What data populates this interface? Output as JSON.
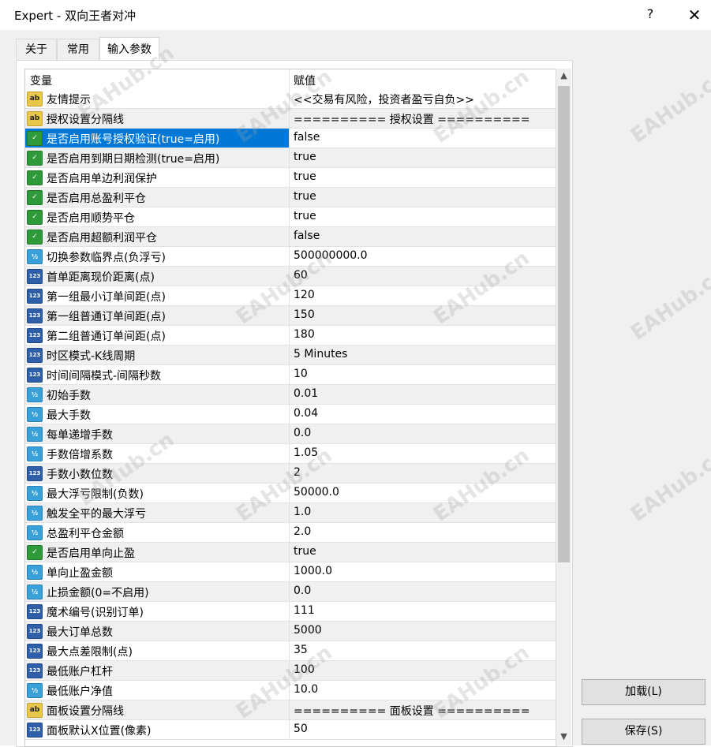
{
  "window": {
    "title": "Expert - 双向王者对冲",
    "help": "?",
    "close": "✕"
  },
  "tabs": [
    {
      "label": "关于"
    },
    {
      "label": "常用"
    },
    {
      "label": "输入参数"
    }
  ],
  "table": {
    "headers": {
      "variable": "变量",
      "value": "赋值"
    },
    "rows": [
      {
        "icon": "ab",
        "name": "友情提示",
        "value": "<<交易有风险，投资者盈亏自负>>"
      },
      {
        "icon": "ab",
        "name": "授权设置分隔线",
        "value": "========== 授权设置 =========="
      },
      {
        "icon": "bool",
        "name": "是否启用账号授权验证(true=启用)",
        "value": "false"
      },
      {
        "icon": "bool",
        "name": "是否启用到期日期检测(true=启用)",
        "value": "true"
      },
      {
        "icon": "bool",
        "name": "是否启用单边利润保护",
        "value": "true"
      },
      {
        "icon": "bool",
        "name": "是否启用总盈利平仓",
        "value": "true"
      },
      {
        "icon": "bool",
        "name": "是否启用顺势平仓",
        "value": "true"
      },
      {
        "icon": "bool",
        "name": "是否启用超额利润平仓",
        "value": "false"
      },
      {
        "icon": "v2",
        "name": "切换参数临界点(负浮亏)",
        "value": "500000000.0"
      },
      {
        "icon": "123",
        "name": "首单距离现价距离(点)",
        "value": "60"
      },
      {
        "icon": "123",
        "name": "第一组最小订单间距(点)",
        "value": "120"
      },
      {
        "icon": "123",
        "name": "第一组普通订单间距(点)",
        "value": "150"
      },
      {
        "icon": "123",
        "name": "第二组普通订单间距(点)",
        "value": "180"
      },
      {
        "icon": "123",
        "name": "时区模式-K线周期",
        "value": "5 Minutes"
      },
      {
        "icon": "123",
        "name": "时间间隔模式-间隔秒数",
        "value": "10"
      },
      {
        "icon": "v2",
        "name": "初始手数",
        "value": "0.01"
      },
      {
        "icon": "v2",
        "name": "最大手数",
        "value": "0.04"
      },
      {
        "icon": "v2",
        "name": "每单递增手数",
        "value": "0.0"
      },
      {
        "icon": "v2",
        "name": "手数倍增系数",
        "value": "1.05"
      },
      {
        "icon": "123",
        "name": "手数小数位数",
        "value": "2"
      },
      {
        "icon": "v2",
        "name": "最大浮亏限制(负数)",
        "value": "50000.0"
      },
      {
        "icon": "v2",
        "name": "触发全平的最大浮亏",
        "value": "1.0"
      },
      {
        "icon": "v2",
        "name": "总盈利平仓金额",
        "value": "2.0"
      },
      {
        "icon": "bool",
        "name": "是否启用单向止盈",
        "value": "true"
      },
      {
        "icon": "v2",
        "name": "单向止盈金额",
        "value": "1000.0"
      },
      {
        "icon": "v2",
        "name": "止损金额(0=不启用)",
        "value": "0.0"
      },
      {
        "icon": "123",
        "name": "魔术编号(识别订单)",
        "value": "111"
      },
      {
        "icon": "123",
        "name": "最大订单总数",
        "value": "5000"
      },
      {
        "icon": "123",
        "name": "最大点差限制(点)",
        "value": "35"
      },
      {
        "icon": "123",
        "name": "最低账户杠杆",
        "value": "100"
      },
      {
        "icon": "v2",
        "name": "最低账户净值",
        "value": "10.0"
      },
      {
        "icon": "ab",
        "name": "面板设置分隔线",
        "value": "========== 面板设置 =========="
      },
      {
        "icon": "123",
        "name": "面板默认X位置(像素)",
        "value": "50"
      }
    ]
  },
  "buttons": {
    "load": "加载(L)",
    "save": "保存(S)"
  },
  "icon_glyphs": {
    "ab": "ab",
    "bool": "✓",
    "v2": "½",
    "123": "123"
  },
  "watermark": "EAHub.cn",
  "scrollbar": {
    "up": "▲",
    "down": "▼"
  }
}
